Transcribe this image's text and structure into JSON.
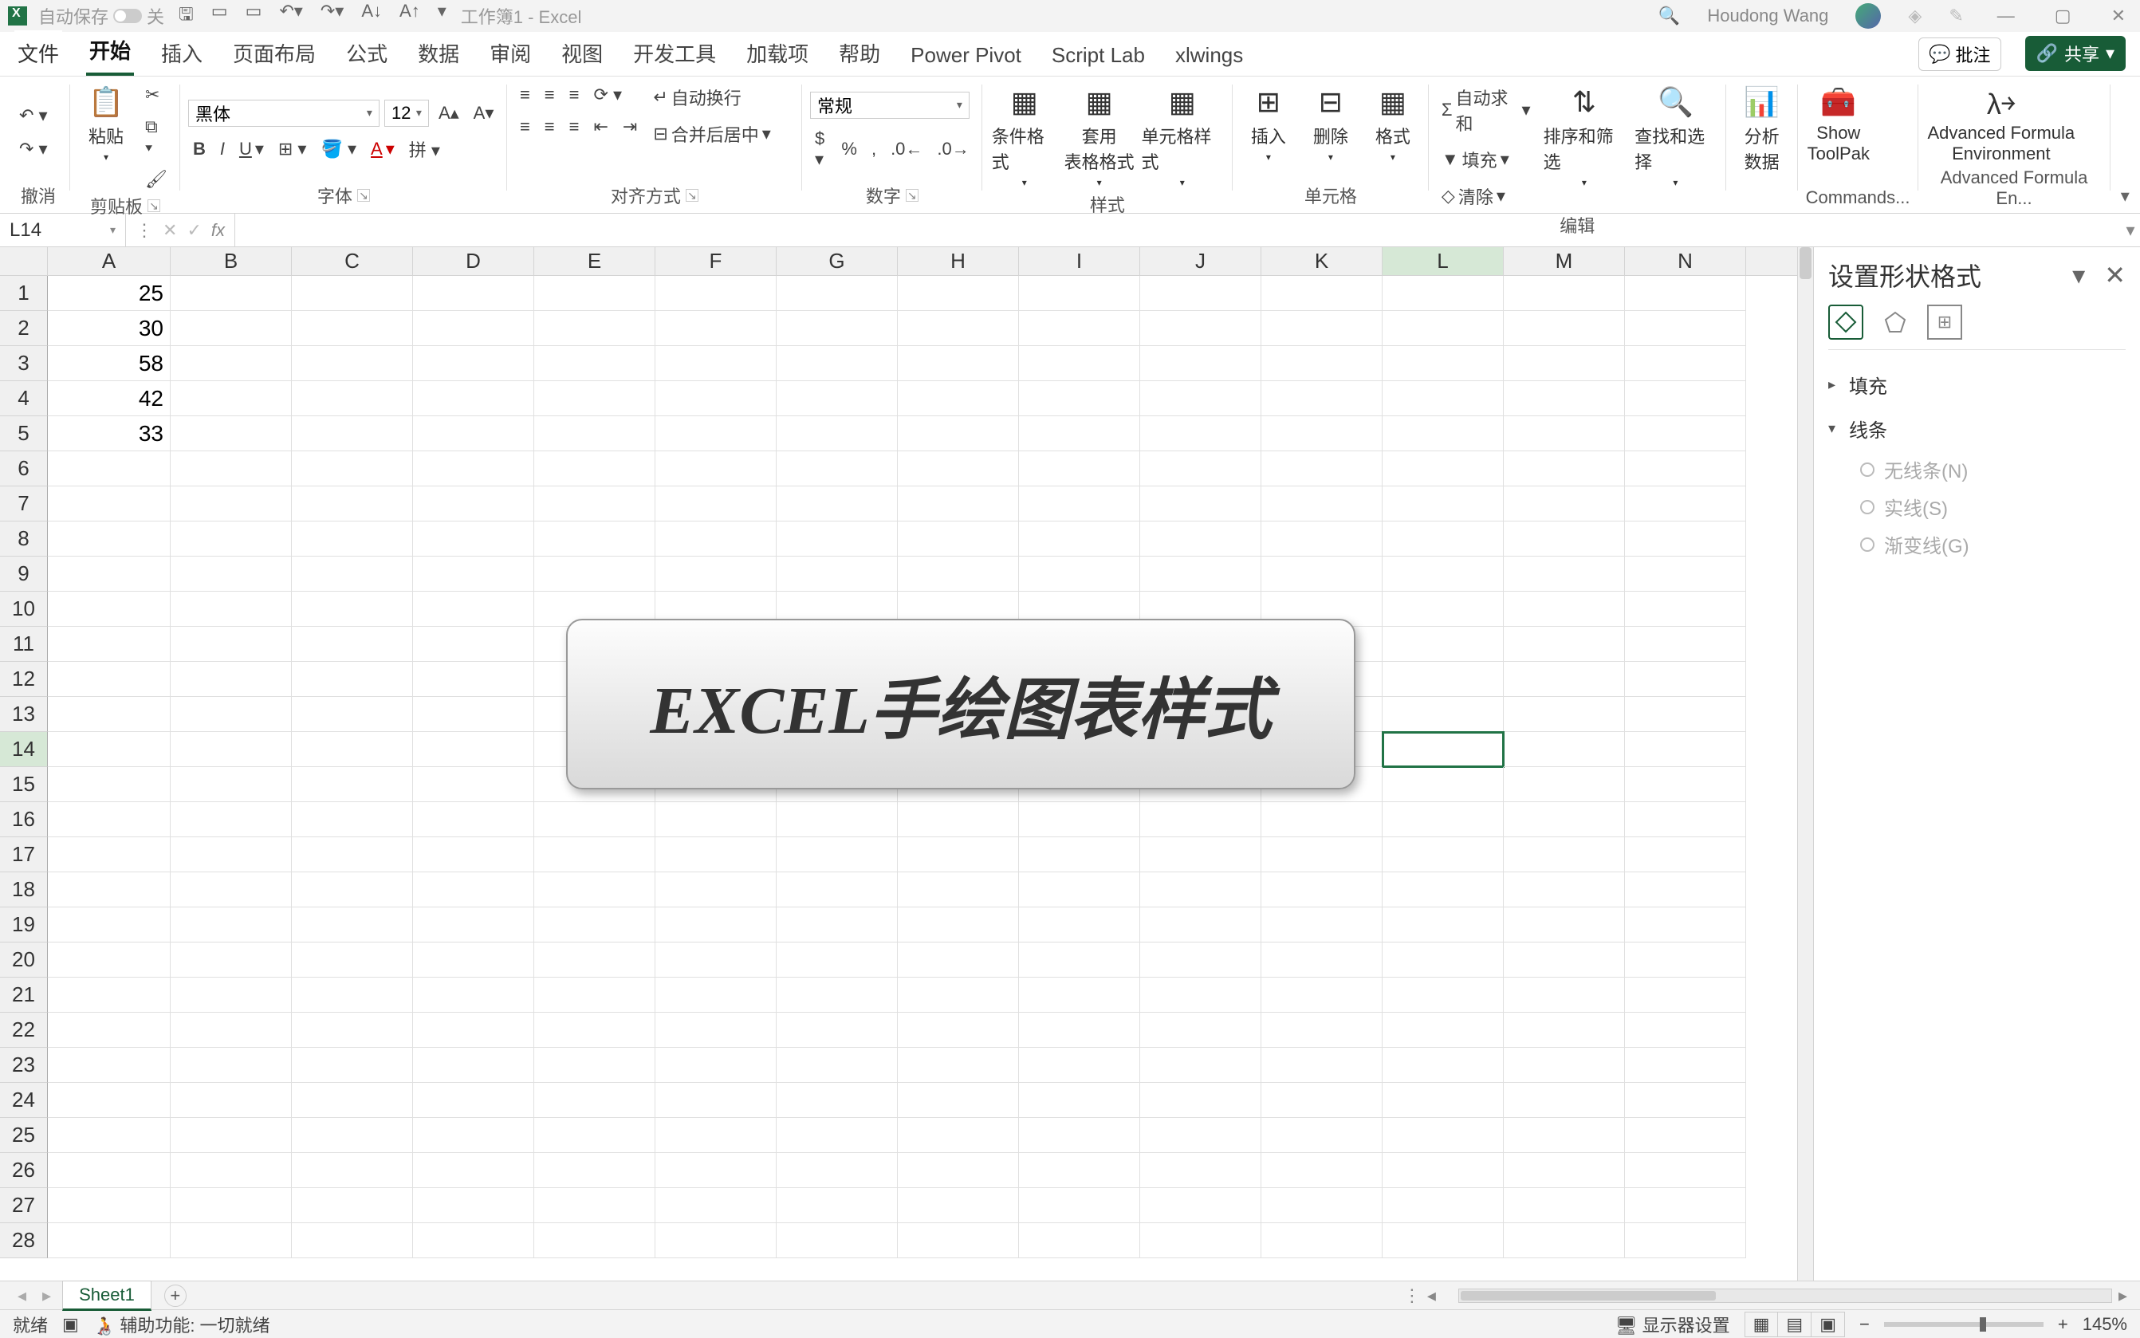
{
  "titlebar": {
    "autosave_label": "自动保存",
    "autosave_off": "关",
    "doc_title": "工作簿1 - Excel",
    "user_name": "Houdong Wang"
  },
  "tabs": {
    "file": "文件",
    "items": [
      "开始",
      "插入",
      "页面布局",
      "公式",
      "数据",
      "审阅",
      "视图",
      "开发工具",
      "加载项",
      "帮助",
      "Power Pivot",
      "Script Lab",
      "xlwings"
    ],
    "active": "开始",
    "comments": "批注",
    "share": "共享"
  },
  "ribbon": {
    "undo_group": "撤消",
    "clipboard_group": "剪贴板",
    "paste": "粘贴",
    "font_group": "字体",
    "font_name": "黑体",
    "font_size": "12",
    "align_group": "对齐方式",
    "wrap": "自动换行",
    "merge": "合并后居中",
    "number_group": "数字",
    "number_format": "常规",
    "styles_group": "样式",
    "cond_fmt": "条件格式",
    "table_fmt": "套用\n表格格式",
    "cell_styles": "单元格样式",
    "cells_group": "单元格",
    "insert": "插入",
    "delete": "删除",
    "format": "格式",
    "editing_group": "编辑",
    "autosum": "自动求和",
    "fill": "填充",
    "clear": "清除",
    "sort_filter": "排序和筛选",
    "find_select": "查找和选择",
    "analyze": "分析\n数据",
    "show_toolpak": "Show\nToolPak",
    "commands": "Commands...",
    "adv_formula": "Advanced Formula\nEnvironment",
    "adv_formula_group": "Advanced Formula En..."
  },
  "formulabar": {
    "namebox": "L14",
    "fx": "fx"
  },
  "grid": {
    "col_widths": {
      "A": 154,
      "B": 152,
      "C": 152,
      "D": 152,
      "E": 152,
      "F": 152,
      "G": 152,
      "H": 152,
      "I": 152,
      "J": 152,
      "K": 152,
      "L": 152,
      "M": 152,
      "N": 152
    },
    "columns": [
      "A",
      "B",
      "C",
      "D",
      "E",
      "F",
      "G",
      "H",
      "I",
      "J",
      "K",
      "L",
      "M",
      "N"
    ],
    "rows": 28,
    "data": {
      "A1": "25",
      "A2": "30",
      "A3": "58",
      "A4": "42",
      "A5": "33"
    },
    "active_cell": "L14",
    "shape_text": "EXCEL手绘图表样式"
  },
  "sidepane": {
    "title": "设置形状格式",
    "fill": "填充",
    "line": "线条",
    "no_line": "无线条(N)",
    "solid": "实线(S)",
    "gradient": "渐变线(G)"
  },
  "sheettabs": {
    "sheet1": "Sheet1"
  },
  "statusbar": {
    "ready": "就绪",
    "accessibility": "辅助功能: 一切就绪",
    "display": "显示器设置",
    "zoom": "145%"
  }
}
